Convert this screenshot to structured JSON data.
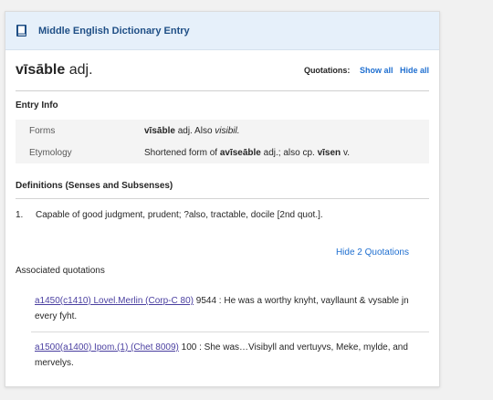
{
  "header": {
    "title": "Middle English Dictionary Entry",
    "icon": "book-icon"
  },
  "entry": {
    "headword": "vīsāble",
    "pos": "adj."
  },
  "quotations_controls": {
    "label": "Quotations:",
    "show_all": "Show all",
    "hide_all": "Hide all"
  },
  "entry_info": {
    "title": "Entry Info",
    "forms_label": "Forms",
    "forms_headword": "vīsāble",
    "forms_pos": "adj. Also",
    "forms_variant": "visibil.",
    "etym_label": "Etymology",
    "etym_prefix": "Shortened form of",
    "etym_word1": "avīseāble",
    "etym_mid": "adj.; also cp.",
    "etym_word2": "vīsen",
    "etym_suffix": "v."
  },
  "definitions": {
    "title": "Definitions (Senses and Subsenses)",
    "senses": [
      {
        "num": "1.",
        "text": "Capable of good judgment, prudent; ?also, tractable, docile [2nd quot.]."
      }
    ],
    "hide_quotations": "Hide 2 Quotations",
    "associated_label": "Associated quotations",
    "quotes": [
      {
        "ref": "a1450(c1410) Lovel.Merlin (Corp-C 80)",
        "line": "9544",
        "text": ": He was a worthy knyht, vayllaunt & vysable jn every fyht."
      },
      {
        "ref": "a1500(a1400) Ipom.(1) (Chet 8009)",
        "line": "100",
        "text": ": She was…Visibyll and vertuyvs, Meke, mylde, and mervelys."
      }
    ]
  }
}
